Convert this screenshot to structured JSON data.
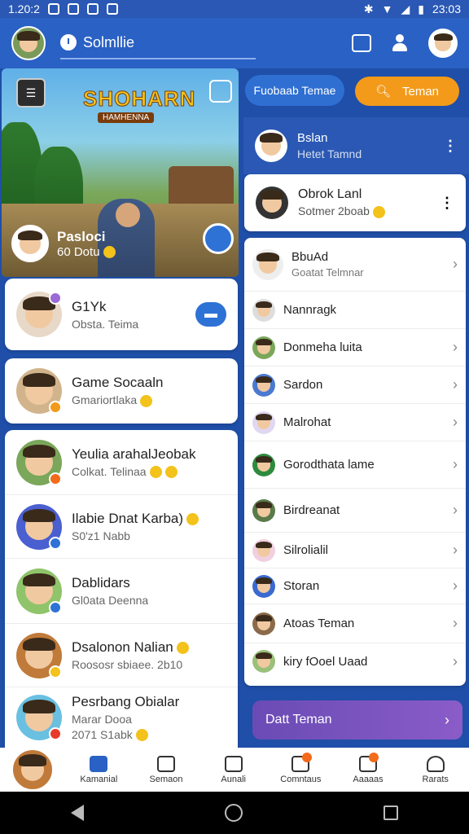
{
  "status": {
    "time_left": "1.20:2",
    "time_right": "23:03"
  },
  "topbar": {
    "search_text": "Solmllie"
  },
  "hero": {
    "title": "SHOHARN",
    "subtitle": "HAMHENNA",
    "user_name": "Pasloci",
    "user_sub": "60 Dotu"
  },
  "left_cards": [
    {
      "name": "G1Yk",
      "sub": "Obsta. Teima"
    },
    {
      "name": "Game Socaaln",
      "sub": "Gmariortlaka"
    }
  ],
  "left_list": [
    {
      "name": "Yeulia arahalJeobak",
      "sub": "Colkat. Telinaa"
    },
    {
      "name": "Ilabie Dnat Karba)",
      "sub": "S0'z1 Nabb"
    },
    {
      "name": "Dablidars",
      "sub": "Gl0ata Deenna"
    },
    {
      "name": "Dsalonon Nalian",
      "sub": "Roososr sbiaee. 2b10"
    },
    {
      "name": "Pesrbang Obialar",
      "sub": "Marar Dooa",
      "sub2": "2071 S1abk"
    }
  ],
  "buttons": {
    "friend_req": "Fuobaab Temae",
    "friends": "Teman"
  },
  "active": {
    "name": "Bslan",
    "sub": "Hetet Tamnd"
  },
  "card2": {
    "name": "Obrok Lanl",
    "sub": "Sotmer 2boab"
  },
  "list": [
    {
      "name": "BbuAd",
      "sub": "Goatat Telmnar"
    },
    {
      "name": "Nannragk"
    },
    {
      "name": "Donmeha luita"
    },
    {
      "name": "Sardon"
    },
    {
      "name": "Malrohat"
    },
    {
      "name": "Gorodthata lame"
    },
    {
      "name": "Birdreanat"
    },
    {
      "name": "Silrolialil"
    },
    {
      "name": "Storan"
    },
    {
      "name": "Atoas Teman"
    },
    {
      "name": "kiry fOoel Uaad"
    }
  ],
  "add_button": "Datt Teman",
  "nav": [
    "Kamanial",
    "Semaon",
    "Aunali",
    "Comntaus",
    "Aaaaas",
    "Rarats"
  ]
}
